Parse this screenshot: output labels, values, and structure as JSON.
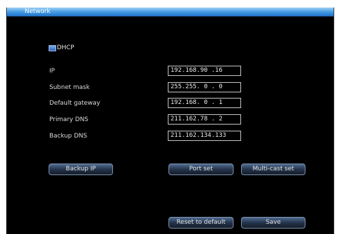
{
  "window": {
    "title": "Network"
  },
  "dhcp": {
    "label": "DHCP",
    "checked": true
  },
  "fields": [
    {
      "label": "IP",
      "value": "192.168.90 .16"
    },
    {
      "label": "Subnet mask",
      "value": "255.255. 0 . 0"
    },
    {
      "label": "Default gateway",
      "value": "192.168. 0 . 1"
    },
    {
      "label": "Primary DNS",
      "value": "211.162.78 . 2"
    },
    {
      "label": "Backup DNS",
      "value": "211.162.134.133"
    }
  ],
  "buttons": {
    "backup_ip": "Backup IP",
    "port_set": "Port set",
    "multicast_set": "Multi-cast set",
    "reset_default": "Reset to default",
    "save": "Save"
  },
  "colors": {
    "titlebar": "#3a8fdc",
    "background": "#000000",
    "text": "#dcdcdc"
  }
}
